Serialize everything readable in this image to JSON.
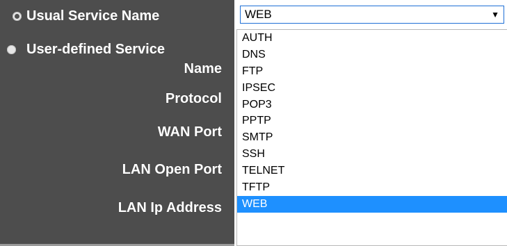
{
  "form": {
    "usual_service_label": "Usual Service Name",
    "user_defined_line1": "User-defined Service",
    "user_defined_line2": "Name",
    "protocol_label": "Protocol",
    "wan_port_label": "WAN Port",
    "lan_open_port_label": "LAN Open Port",
    "lan_ip_label": "LAN Ip Address"
  },
  "service_select": {
    "value": "WEB",
    "arrow": "▼",
    "options": [
      "AUTH",
      "DNS",
      "FTP",
      "IPSEC",
      "POP3",
      "PPTP",
      "SMTP",
      "SSH",
      "TELNET",
      "TFTP",
      "WEB"
    ],
    "selected_index": 10
  },
  "colors": {
    "panel_bg": "#4d4d4d",
    "highlight": "#1e90ff",
    "select_border": "#1e6fd6"
  }
}
